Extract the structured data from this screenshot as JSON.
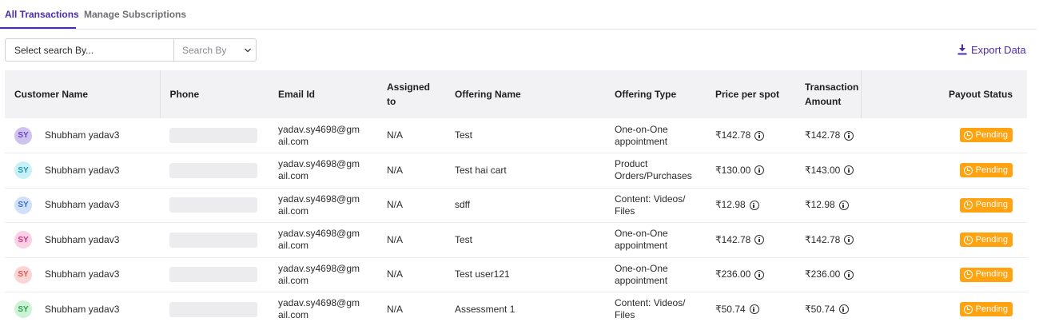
{
  "tabs": [
    {
      "label": "All Transactions",
      "active": true
    },
    {
      "label": "Manage Subscriptions",
      "active": false
    }
  ],
  "search": {
    "placeholder": "Select search By...",
    "select_label": "Search By"
  },
  "export": {
    "label": "Export Data",
    "icon": "download-icon"
  },
  "colors": {
    "accent": "#4b2bb0",
    "pending": "#ffa311"
  },
  "table": {
    "headers": {
      "customer": "Customer Name",
      "phone": "Phone",
      "email": "Email Id",
      "assigned_1": "Assigned",
      "assigned_2": "to",
      "offering_name": "Offering Name",
      "offering_type": "Offering Type",
      "price": "Price per spot",
      "amount_1": "Transaction",
      "amount_2": "Amount",
      "payout": "Payout Status"
    },
    "rows": [
      {
        "initials": "SY",
        "avatar_bg": "#cfc2ef",
        "avatar_fg": "#6b43c7",
        "name": "Shubham yadav3",
        "email_1": "yadav.sy4698@gm",
        "email_2": "ail.com",
        "assigned": "N/A",
        "offering_name": "Test",
        "type_1": "One-on-One",
        "type_2": "appointment",
        "price": "₹142.78",
        "amount": "₹142.78",
        "status": "Pending"
      },
      {
        "initials": "SY",
        "avatar_bg": "#c8f1f7",
        "avatar_fg": "#1b95b0",
        "name": "Shubham yadav3",
        "email_1": "yadav.sy4698@gm",
        "email_2": "ail.com",
        "assigned": "N/A",
        "offering_name": "Test hai cart",
        "type_1": "Product",
        "type_2": "Orders/Purchases",
        "price": "₹130.00",
        "amount": "₹143.00",
        "status": "Pending"
      },
      {
        "initials": "SY",
        "avatar_bg": "#d0e0fb",
        "avatar_fg": "#3b6fd1",
        "name": "Shubham yadav3",
        "email_1": "yadav.sy4698@gm",
        "email_2": "ail.com",
        "assigned": "N/A",
        "offering_name": "sdff",
        "type_1": "Content: Videos/",
        "type_2": "Files",
        "price": "₹12.98",
        "amount": "₹12.98",
        "status": "Pending"
      },
      {
        "initials": "SY",
        "avatar_bg": "#fbcfe4",
        "avatar_fg": "#d63384",
        "name": "Shubham yadav3",
        "email_1": "yadav.sy4698@gm",
        "email_2": "ail.com",
        "assigned": "N/A",
        "offering_name": "Test",
        "type_1": "One-on-One",
        "type_2": "appointment",
        "price": "₹142.78",
        "amount": "₹142.78",
        "status": "Pending"
      },
      {
        "initials": "SY",
        "avatar_bg": "#fbd5d5",
        "avatar_fg": "#e0574f",
        "name": "Shubham yadav3",
        "email_1": "yadav.sy4698@gm",
        "email_2": "ail.com",
        "assigned": "N/A",
        "offering_name": "Test user121",
        "type_1": "One-on-One",
        "type_2": "appointment",
        "price": "₹236.00",
        "amount": "₹236.00",
        "status": "Pending"
      },
      {
        "initials": "SY",
        "avatar_bg": "#cdf3d6",
        "avatar_fg": "#2e9e4f",
        "name": "Shubham yadav3",
        "email_1": "yadav.sy4698@gm",
        "email_2": "ail.com",
        "assigned": "N/A",
        "offering_name": "Assessment 1",
        "type_1": "Content: Videos/",
        "type_2": "Files",
        "price": "₹50.74",
        "amount": "₹50.74",
        "status": "Pending"
      }
    ]
  }
}
